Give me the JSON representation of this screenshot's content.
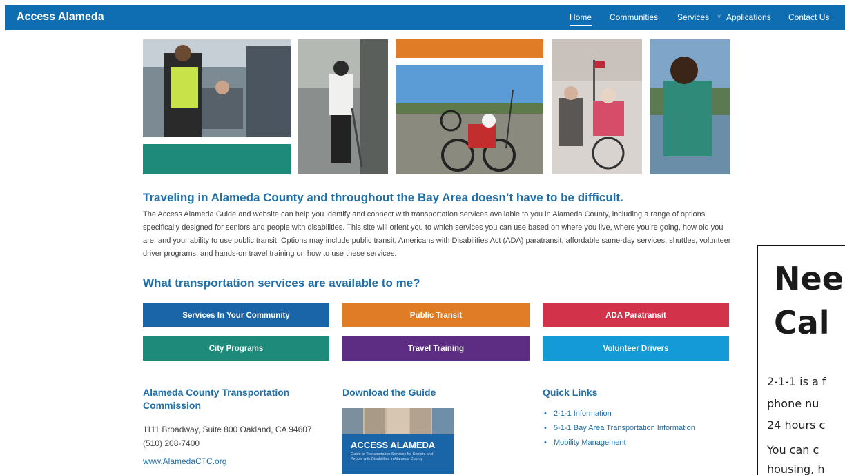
{
  "nav": {
    "brand": "Access Alameda",
    "items": [
      "Home",
      "Communities",
      "Services",
      "Applications",
      "Contact Us"
    ],
    "caret": "˅"
  },
  "colors": {
    "nav": "#0f6db1",
    "teal": "#1e8a7a",
    "orange": "#e07b26",
    "blue": "#1a64a8",
    "red": "#d2334a",
    "purple": "#5c2d82",
    "skyblue": "#159ad8",
    "heading": "#1f6fa8"
  },
  "intro": {
    "heading": "Traveling in Alameda County and throughout the Bay Area doesn’t have to be difficult.",
    "body": "The Access Alameda Guide and website can help you identify and connect with transportation services available to you in Alameda County, including a range of options specifically designed for seniors and people with disabilities. This site will orient you to which services you can use based on where you live, where you’re going, how old you are, and your ability to use public transit. Options may include public transit, Americans with Disabilities Act (ADA) paratransit, affordable same-day services, shuttles, volunteer driver programs, and hands-on travel training on how to use these services."
  },
  "services": {
    "heading": "What transportation services are available to me?",
    "buttons": [
      "Services In Your Community",
      "Public Transit",
      "ADA Paratransit",
      "City Programs",
      "Travel Training",
      "Volunteer Drivers"
    ]
  },
  "commission": {
    "heading": "Alameda County Transportation Commission",
    "address": "1111 Broadway, Suite 800 Oakland, CA 94607",
    "phone": "(510) 208-7400",
    "url": "www.AlamedaCTC.org"
  },
  "guide": {
    "heading": "Download the Guide",
    "cover_title": "ACCESS ALAMEDA",
    "cover_subtitle": "Guide to Transportation Services for Seniors and People with Disabilities in Alameda County"
  },
  "quick_links": {
    "heading": "Quick Links",
    "items": [
      "2-1-1 Information",
      "5-1-1 Bay Area Transportation Information",
      "Mobility Management"
    ]
  },
  "popup": {
    "line1": "Nee",
    "line2": "Cal",
    "text1": "2-1-1 is a f",
    "text2": "phone nu",
    "text3": "24 hours c",
    "text4": "You can c",
    "text5": "housing, h"
  }
}
